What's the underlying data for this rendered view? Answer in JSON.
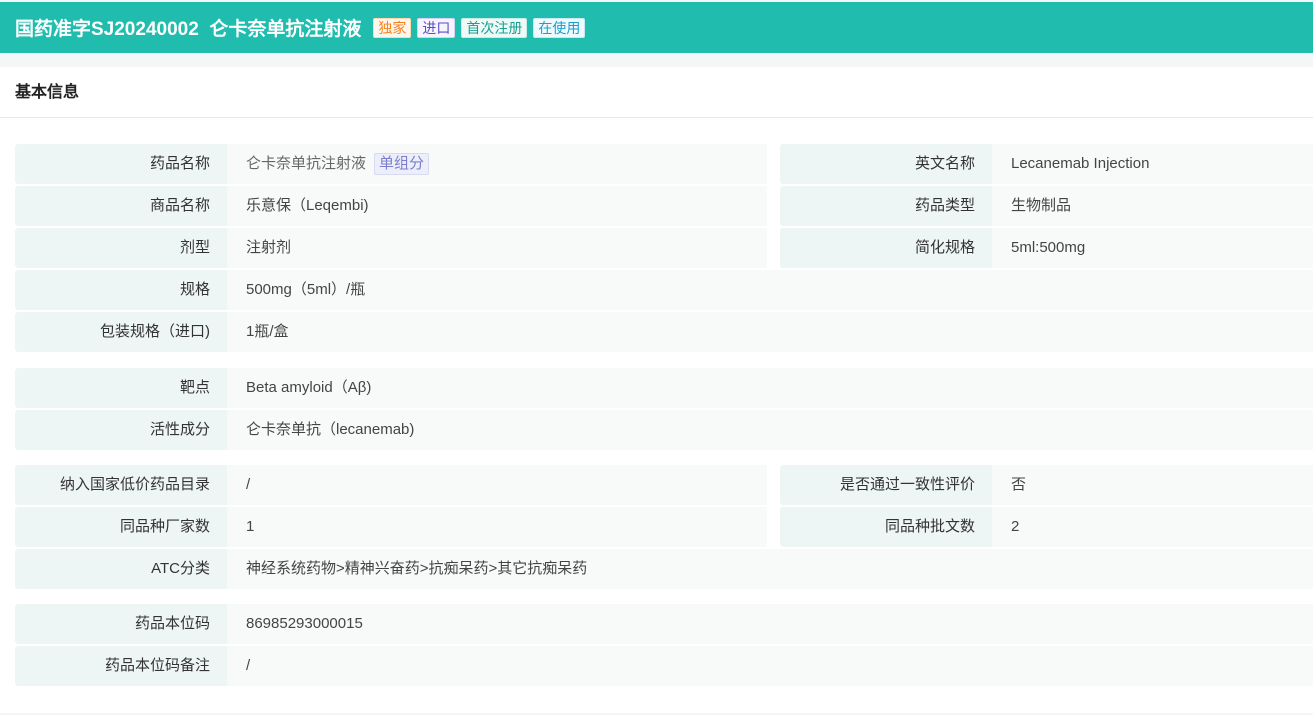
{
  "header": {
    "title": "国药准字SJ20240002  仑卡奈单抗注射液",
    "tags": [
      "独家",
      "进口",
      "首次注册",
      "在使用"
    ]
  },
  "section_title": "基本信息",
  "block1": [
    {
      "label": "药品名称",
      "value": "仑卡奈单抗注射液",
      "badge": "单组分",
      "label2": "英文名称",
      "value2": "Lecanemab Injection"
    },
    {
      "label": "商品名称",
      "value": "乐意保（Leqembi)",
      "label2": "药品类型",
      "value2": "生物制品"
    },
    {
      "label": "剂型",
      "value": "注射剂",
      "label2": "简化规格",
      "value2": "5ml:500mg"
    },
    {
      "label": "规格",
      "value": "500mg（5ml）/瓶"
    },
    {
      "label": "包装规格（进口)",
      "value": "1瓶/盒"
    }
  ],
  "block2": [
    {
      "label": "靶点",
      "value": "Beta amyloid（Aβ)"
    },
    {
      "label": "活性成分",
      "value": "仑卡奈单抗（lecanemab)"
    }
  ],
  "block3": [
    {
      "label": "纳入国家低价药品目录",
      "value": "/",
      "label2": "是否通过一致性评价",
      "value2": "否"
    },
    {
      "label": "同品种厂家数",
      "value": "1",
      "label2": "同品种批文数",
      "value2": "2"
    },
    {
      "label": "ATC分类",
      "value": "神经系统药物>精神兴奋药>抗痴呆药>其它抗痴呆药"
    }
  ],
  "block4": [
    {
      "label": "药品本位码",
      "value": "86985293000015"
    },
    {
      "label": "药品本位码备注",
      "value": "/"
    }
  ]
}
